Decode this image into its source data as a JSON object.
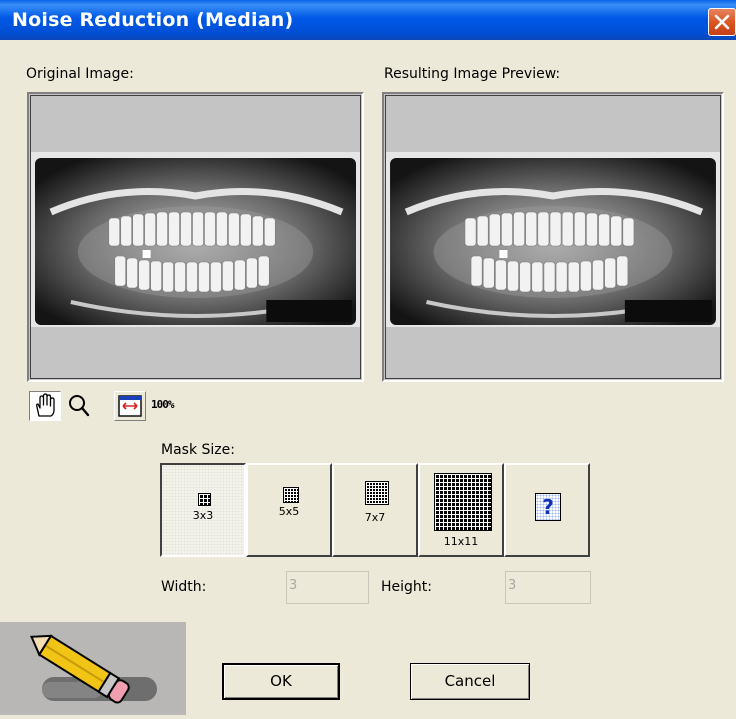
{
  "window": {
    "title": "Noise Reduction (Median)",
    "close_icon": "close-icon"
  },
  "original_image": {
    "label": "Original Image:"
  },
  "preview_image": {
    "label": "Resulting Image Preview:"
  },
  "toolbar": {
    "pan_icon": "hand-icon",
    "zoom_icon": "magnifier-icon",
    "fit_icon": "fit-to-window-icon",
    "actual_size_label": "100%"
  },
  "mask_size": {
    "label": "Mask Size:",
    "selected": "3x3",
    "options": [
      {
        "label": "3x3",
        "icon": "grid-3x3-icon"
      },
      {
        "label": "5x5",
        "icon": "grid-5x5-icon"
      },
      {
        "label": "7x7",
        "icon": "grid-7x7-icon"
      },
      {
        "label": "11x11",
        "icon": "grid-11x11-icon"
      }
    ],
    "custom_icon": "question-mark-icon"
  },
  "dimensions": {
    "width_label": "Width:",
    "width_value": "3",
    "height_label": "Height:",
    "height_value": "3"
  },
  "buttons": {
    "ok": "OK",
    "cancel": "Cancel"
  },
  "colors": {
    "title_bar": "#0058e6",
    "dialog_background": "#ece9d8",
    "image_background": "#c4c4c4",
    "close_button": "#d9531e"
  }
}
